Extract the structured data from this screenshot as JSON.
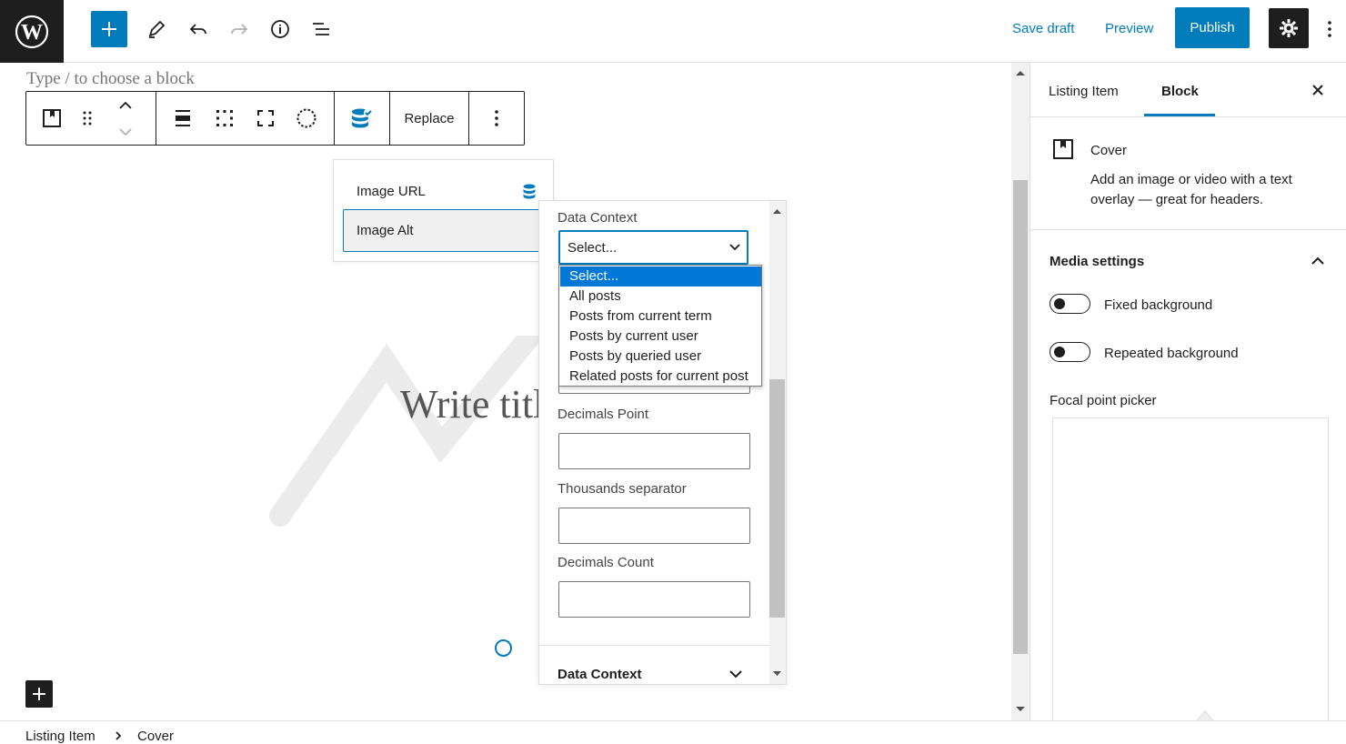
{
  "header": {
    "save_draft": "Save draft",
    "preview": "Preview",
    "publish": "Publish"
  },
  "editor": {
    "type_hint": "Type / to choose a block",
    "toolbar": {
      "replace": "Replace"
    },
    "dynamic_fields": [
      "Image URL",
      "Image Alt"
    ],
    "cover_title_placeholder": "Write titl"
  },
  "settings_popover": {
    "data_context_label": "Data Context",
    "select_value": "Select...",
    "options": [
      "Select...",
      "All posts",
      "Posts from current term",
      "Posts by current user",
      "Posts by queried user",
      "Related posts for current post"
    ],
    "decimals_point_label": "Decimals Point",
    "thousands_separator_label": "Thousands separator",
    "decimals_count_label": "Decimals Count",
    "footer_title": "Data Context"
  },
  "sidebar": {
    "tabs": [
      "Listing Item",
      "Block"
    ],
    "active_tab": "Block",
    "block_name": "Cover",
    "block_description": "Add an image or video with a text overlay — great for headers.",
    "media_settings_title": "Media settings",
    "fixed_background": "Fixed background",
    "repeated_background": "Repeated background",
    "focal_point_picker": "Focal point picker"
  },
  "breadcrumb": [
    "Listing Item",
    "Cover"
  ],
  "colors": {
    "accent": "#007cba",
    "dark": "#1e1e1e",
    "option_selected": "#0078d7"
  }
}
